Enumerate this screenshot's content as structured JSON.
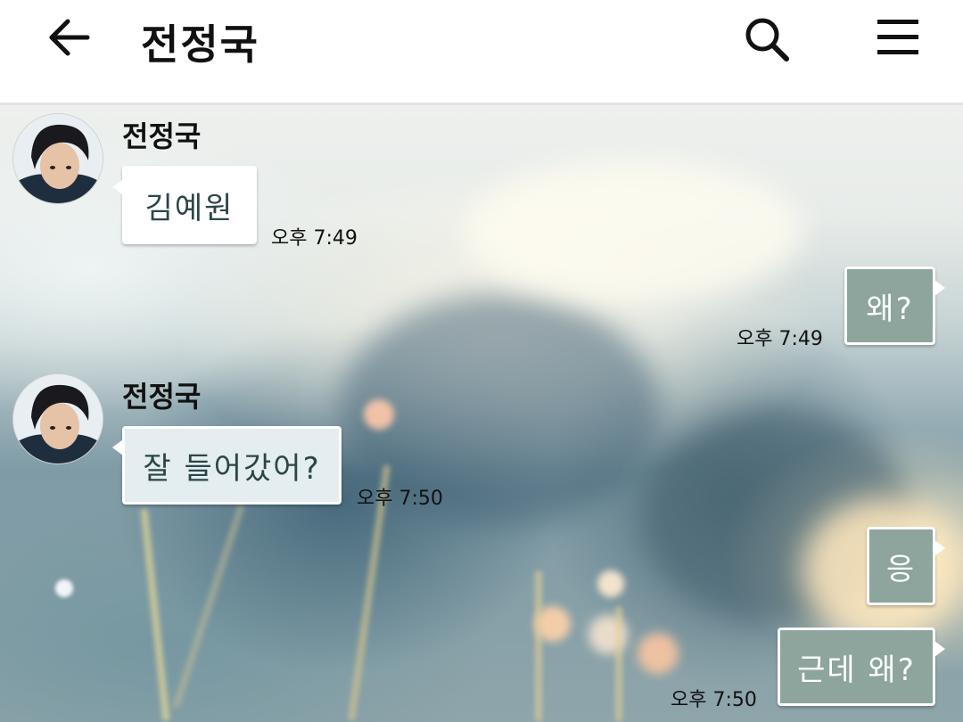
{
  "header": {
    "title": "전정국",
    "back_icon": "arrow-left-icon",
    "search_icon": "search-icon",
    "menu_icon": "hamburger-menu-icon"
  },
  "messages": [
    {
      "direction": "incoming",
      "sender": "전정국",
      "text": "김예원",
      "time": "오후 7:49"
    },
    {
      "direction": "outgoing",
      "text": "왜?",
      "time": "오후 7:49"
    },
    {
      "direction": "incoming",
      "sender": "전정국",
      "text": "잘 들어갔어?",
      "time": "오후 7:50"
    },
    {
      "direction": "outgoing",
      "text": "응",
      "time": ""
    },
    {
      "direction": "outgoing",
      "text": "근데 왜?",
      "time": "오후 7:50"
    }
  ],
  "colors": {
    "outgoing_bubble": "#8da59c",
    "incoming_bubble": "#ffffff",
    "incoming_text": "#2c4648",
    "header_bg": "#ffffff"
  }
}
